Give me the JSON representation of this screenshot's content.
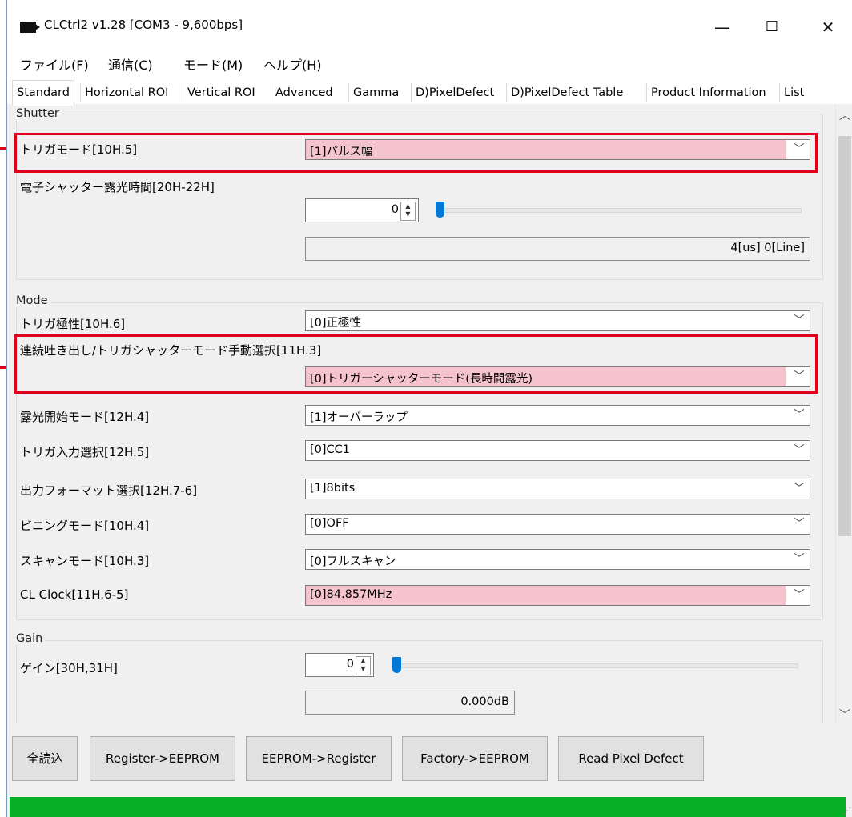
{
  "window": {
    "title": "CLCtrl2 v1.28  [COM3 - 9,600bps]",
    "minimize_glyph": "—",
    "maximize_glyph": "☐",
    "close_glyph": "✕"
  },
  "menu": [
    "ファイル(F)",
    "通信(C)",
    "モード(M)",
    "ヘルプ(H)"
  ],
  "tabs": [
    "Standard",
    "Horizontal ROI",
    "Vertical ROI",
    "Advanced",
    "Gamma",
    "D)PixelDefect",
    "D)PixelDefect Table",
    "Product Information",
    "List"
  ],
  "shutter": {
    "group_title": "Shutter",
    "trigger_mode_label": "トリガモード[10H.5]",
    "trigger_mode_value": "[1]パルス幅",
    "exposure_label": "電子シャッター露光時間[20H-22H]",
    "exposure_spin_value": "0",
    "exposure_readout": "4[us] 0[Line]",
    "exposure_slider_fraction": 0
  },
  "mode": {
    "group_title": "Mode",
    "polarity_label": "トリガ極性[10H.6]",
    "polarity_value": "[0]正極性",
    "manual_select_label": "連続吐き出し/トリガシャッターモード手動選択[11H.3]",
    "manual_select_value": "[0]トリガーシャッターモード(長時間露光)",
    "exposure_start_label": "露光開始モード[12H.4]",
    "exposure_start_value": "[1]オーバーラップ",
    "trigger_input_label": "トリガ入力選択[12H.5]",
    "trigger_input_value": "[0]CC1",
    "output_format_label": "出力フォーマット選択[12H.7-6]",
    "output_format_value": "[1]8bits",
    "binning_label": "ビニングモード[10H.4]",
    "binning_value": "[0]OFF",
    "scan_label": "スキャンモード[10H.3]",
    "scan_value": "[0]フルスキャン",
    "clock_label": "CL Clock[11H.6-5]",
    "clock_value": "[0]84.857MHz"
  },
  "gain": {
    "group_title": "Gain",
    "gain_label": "ゲイン[30H,31H]",
    "gain_spin_value": "0",
    "gain_readout": "0.000dB",
    "gain_slider_fraction": 0
  },
  "buttons": {
    "read_all": "全読込",
    "reg_to_eeprom": "Register->EEPROM",
    "eeprom_to_reg": "EEPROM->Register",
    "factory_to_eeprom": "Factory->EEPROM",
    "read_pixel_defect": "Read Pixel Defect"
  },
  "progress_fraction": 1.0,
  "colors": {
    "highlight_red": "#e0001a",
    "changed_field_pink": "#f5c3cc",
    "progress_green": "#06b025",
    "slider_blue": "#0078d7"
  }
}
